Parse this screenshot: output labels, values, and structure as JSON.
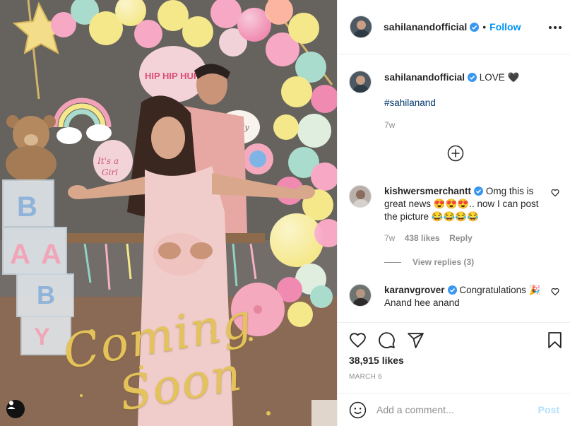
{
  "post": {
    "username": "sahilanandofficial",
    "follow_label": "Follow",
    "separator": "•",
    "photo_overlay": {
      "line1": "Coming",
      "line2": "Soon"
    }
  },
  "caption": {
    "username": "sahilanandofficial",
    "text": "LOVE 🖤",
    "hashtag": "#sahilanand",
    "time": "7w"
  },
  "comments": [
    {
      "username": "kishwersmerchantt",
      "text": "Omg this is great news 😍😍😍.. now I can post the picture 😂😂😂😂",
      "time": "7w",
      "likes": "438 likes",
      "reply_label": "Reply",
      "view_replies": "View replies (3)"
    },
    {
      "username": "karanvgrover",
      "text": "Congratulations 🎉",
      "text2": "Anand hee anand"
    }
  ],
  "actions": {
    "likes": "38,915 likes",
    "date": "MARCH 6"
  },
  "composer": {
    "placeholder": "Add a comment...",
    "post_label": "Post"
  },
  "colors": {
    "link_blue": "#0095f6",
    "muted": "#8e8e8e",
    "post_disabled": "#b2dffc"
  },
  "icons": [
    "verified-badge-icon",
    "more-options-icon",
    "heart-icon",
    "comment-icon",
    "share-icon",
    "bookmark-icon",
    "smile-icon",
    "plus-circle-icon",
    "user-tag-icon"
  ]
}
